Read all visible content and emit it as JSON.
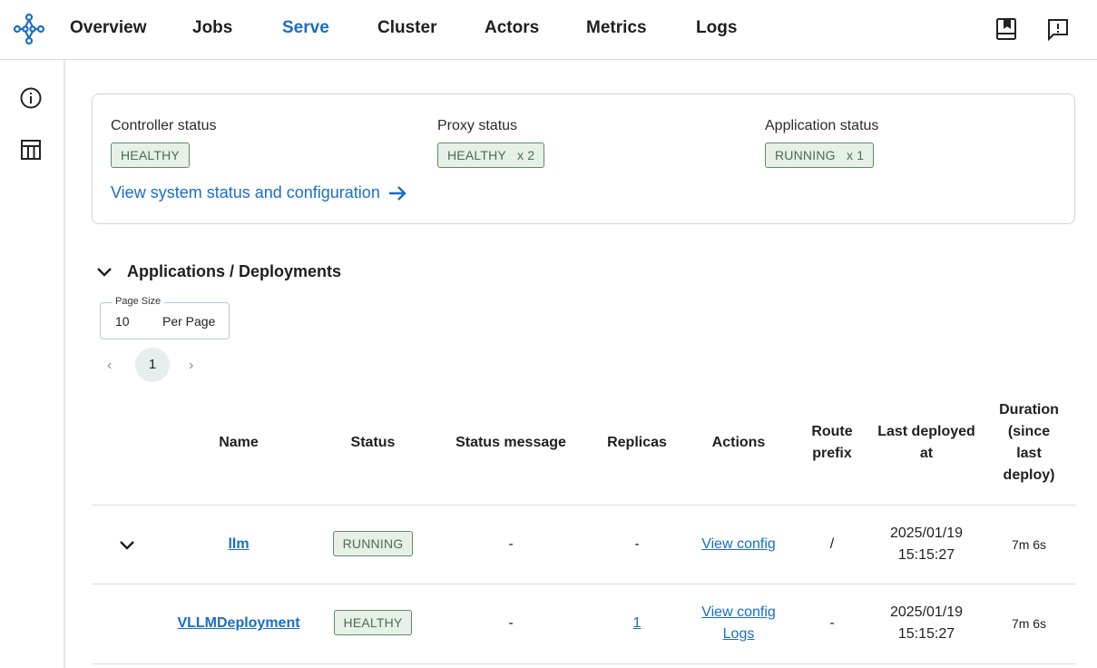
{
  "nav": {
    "items": [
      "Overview",
      "Jobs",
      "Serve",
      "Cluster",
      "Actors",
      "Metrics",
      "Logs"
    ],
    "active": "Serve"
  },
  "top_icons": [
    "docs-book-icon",
    "feedback-icon"
  ],
  "side_icons": [
    "info-icon",
    "table-icon"
  ],
  "status": {
    "controller": {
      "label": "Controller status",
      "badge": "HEALTHY"
    },
    "proxy": {
      "label": "Proxy status",
      "badge": "HEALTHY   x 2"
    },
    "application": {
      "label": "Application status",
      "badge": "RUNNING   x 1"
    },
    "link": "View system status and configuration"
  },
  "section": {
    "title": "Applications / Deployments"
  },
  "page_size": {
    "label": "Page Size",
    "value": "10",
    "unit": "Per Page"
  },
  "pagination": {
    "current": "1"
  },
  "table": {
    "headers": {
      "name": "Name",
      "status": "Status",
      "status_message": "Status message",
      "replicas": "Replicas",
      "actions": "Actions",
      "route_prefix": "Route prefix",
      "last_deployed": "Last deployed at",
      "duration": "Duration (since last deploy)"
    },
    "rows": [
      {
        "name": "llm",
        "status": "RUNNING",
        "status_message": "-",
        "replicas": "-",
        "action_config": "View config",
        "route_prefix": "/",
        "last_deployed_date": "2025/01/19",
        "last_deployed_time": "15:15:27",
        "duration": "7m 6s"
      },
      {
        "name": "VLLMDeployment",
        "status": "HEALTHY",
        "status_message": "-",
        "replicas": "1",
        "action_config": "View config",
        "action_logs": "Logs",
        "route_prefix": "-",
        "last_deployed_date": "2025/01/19",
        "last_deployed_time": "15:15:27",
        "duration": "7m 6s"
      }
    ]
  },
  "colors": {
    "accent": "#1a6dc7",
    "badge_border": "#5f8a66",
    "badge_bg": "#e6f0e6",
    "badge_text": "#4e6b53"
  }
}
